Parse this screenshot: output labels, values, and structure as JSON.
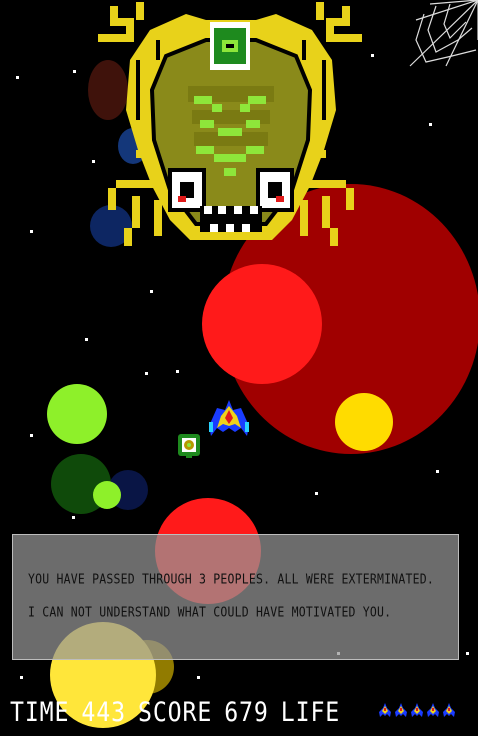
{
  "dialog": {
    "line1": "YOU HAVE PASSED THROUGH 3 PEOPLES. ALL WERE EXTERMINATED.",
    "line2": "I CAN NOT UNDERSTAND WHAT COULD HAVE MOTIVATED YOU."
  },
  "hud": {
    "time_label": "TIME",
    "time_value": "443",
    "score_label": "SCORE",
    "score_value": "679",
    "life_label": "LIFE",
    "lives_count": 5
  },
  "icons": [
    "spiderweb-icon",
    "boss-alien-icon",
    "player-ship-icon",
    "item-capsule-icon",
    "life-ship-icon"
  ],
  "colors": {
    "background": "#000000",
    "boss_yellow": "#e8d21a",
    "boss_olive": "#8a8a1a",
    "boss_green": "#8ee63a",
    "red_orb": "#ff1a1a",
    "dark_red_orb": "#a00000",
    "green_orb": "#8ef02a",
    "dark_green_orb": "#0f4a0a",
    "yellow_orb": "#ffdc00"
  }
}
